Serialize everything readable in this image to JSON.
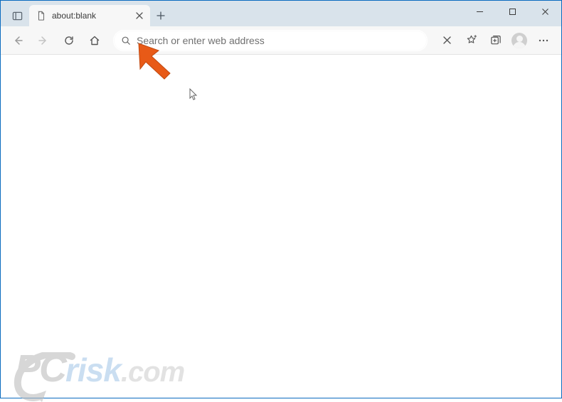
{
  "tab": {
    "title": "about:blank"
  },
  "addressbar": {
    "placeholder": "Search or enter web address",
    "value": ""
  },
  "watermark": {
    "part1": "PC",
    "part2": "risk",
    "part3": ".com"
  }
}
